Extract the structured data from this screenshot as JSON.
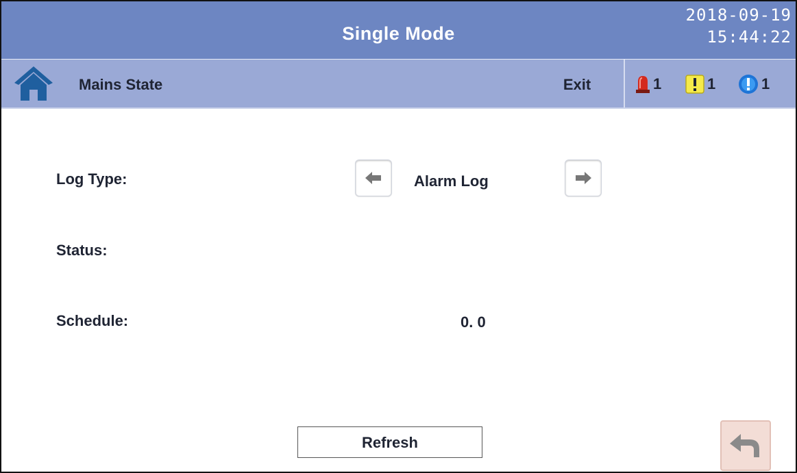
{
  "header": {
    "title": "Single Mode",
    "date": "2018-09-19",
    "time": "15:44:22"
  },
  "subheader": {
    "page_name": "Mains State",
    "exit_label": "Exit",
    "alarms": [
      {
        "icon": "red-siren-icon",
        "count": "1"
      },
      {
        "icon": "yellow-warning-icon",
        "count": "1"
      },
      {
        "icon": "blue-info-icon",
        "count": "1"
      }
    ]
  },
  "form": {
    "log_type_label": "Log Type:",
    "log_type_value": "Alarm Log",
    "status_label": "Status:",
    "status_value": "",
    "schedule_label": "Schedule:",
    "schedule_value": "0. 0"
  },
  "footer": {
    "refresh_label": "Refresh"
  },
  "colors": {
    "header_bg": "#6d86c2",
    "subheader_bg": "#9aa9d6",
    "back_button_bg": "#f3ddd6"
  }
}
